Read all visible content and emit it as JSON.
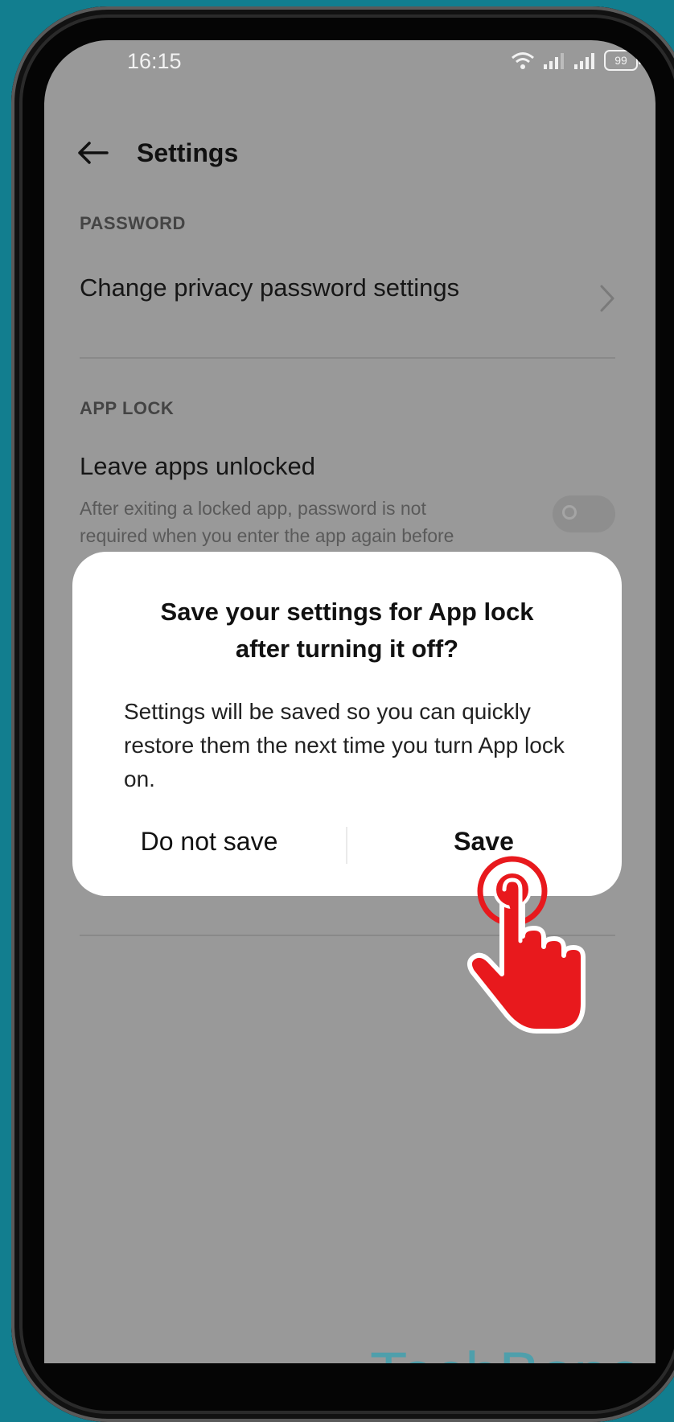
{
  "status_bar": {
    "time": "16:15",
    "battery": "99"
  },
  "header": {
    "title": "Settings"
  },
  "password_section": {
    "label": "PASSWORD",
    "items": [
      {
        "title": "Change privacy password settings"
      }
    ]
  },
  "app_lock_section": {
    "label": "APP LOCK",
    "items": [
      {
        "title": "Leave apps unlocked",
        "subtitle": "After exiting a locked app, password is not required when you enter the app again before",
        "toggle_on": false
      }
    ]
  },
  "dialog": {
    "title_line1": "Save your settings for App lock",
    "title_line2": "after turning it off?",
    "message": "Settings will be saved so you can quickly restore them the next time you turn App lock on.",
    "secondary_button": "Do not save",
    "primary_button": "Save"
  },
  "watermark": "TechBone",
  "colors": {
    "background": "#127e8f",
    "screen_dim": "#999999",
    "dialog": "#ffffff",
    "tap_indicator": "#e8191d"
  }
}
